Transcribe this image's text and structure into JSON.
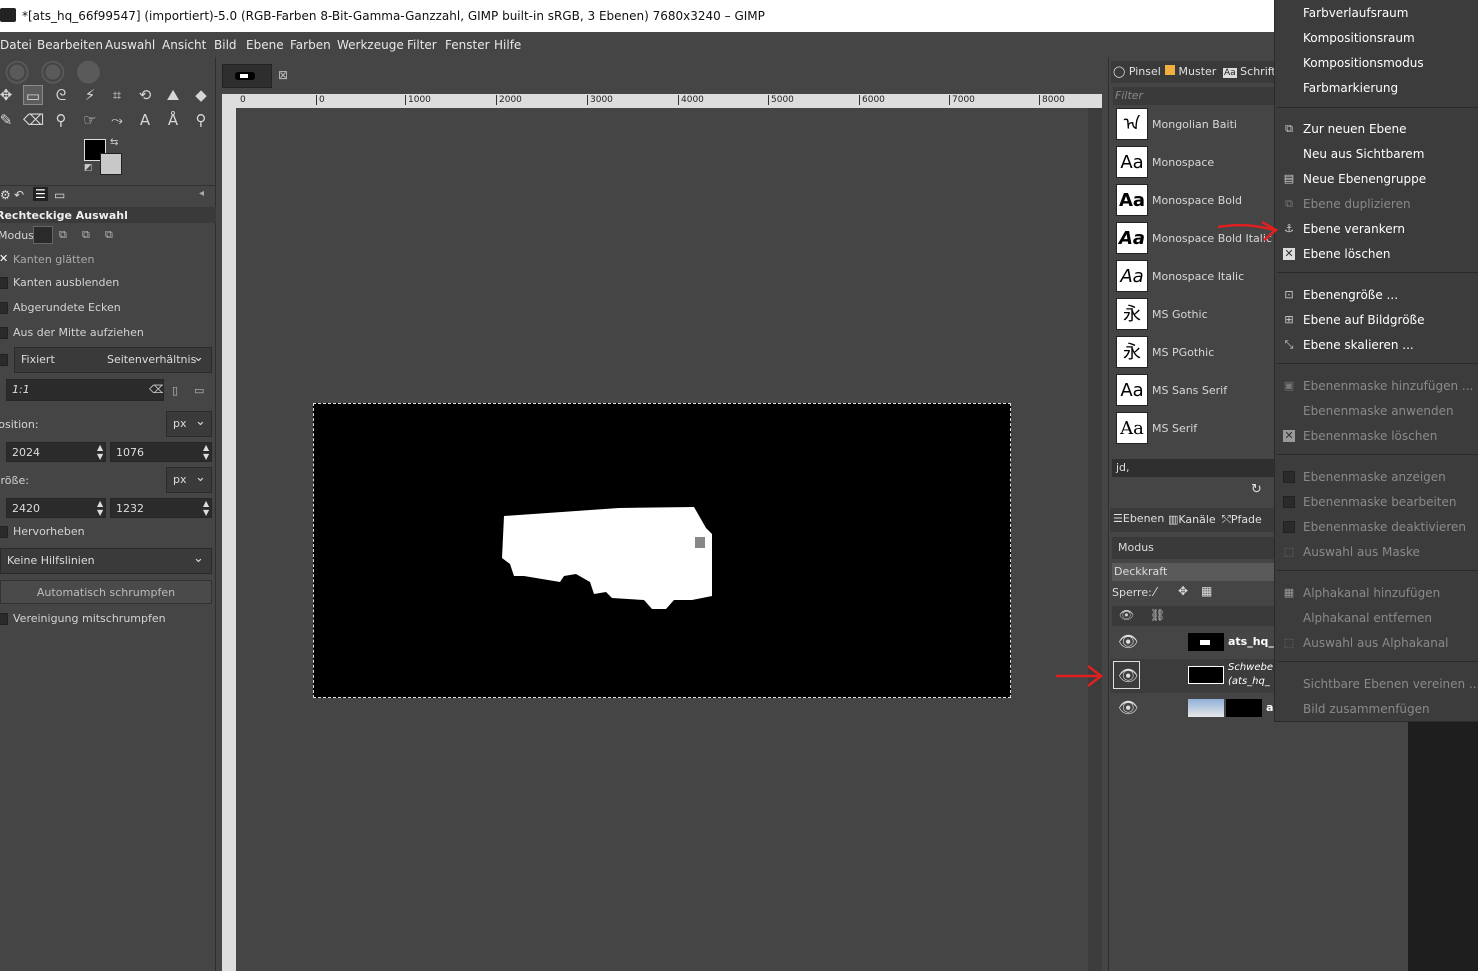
{
  "title": "*[ats_hq_66f99547] (importiert)-5.0 (RGB-Farben 8-Bit-Gamma-Ganzzahl, GIMP built-in sRGB, 3 Ebenen) 7680x3240 – GIMP",
  "menubar": [
    "Datei",
    "Bearbeiten",
    "Auswahl",
    "Ansicht",
    "Bild",
    "Ebene",
    "Farben",
    "Werkzeuge",
    "Filter",
    "Fenster",
    "Hilfe"
  ],
  "tool_options": {
    "header": "Rechteckige Auswahl",
    "mode_label": "Modus:",
    "antialias": "Kanten glätten",
    "feather": "Kanten ausblenden",
    "rounded": "Abgerundete Ecken",
    "from_center": "Aus der Mitte aufziehen",
    "fixed": "Fixiert",
    "fixed_mode": "Seitenverhältnis",
    "ratio": "1:1",
    "position_label": "Position:",
    "size_label": "Größe:",
    "unit": "px",
    "pos_x": "2024",
    "pos_y": "1076",
    "size_w": "2420",
    "size_h": "1232",
    "highlight": "Hervorheben",
    "guides": "Keine Hilfslinien",
    "autoshrink": "Automatisch schrumpfen",
    "merge_shrink": "Vereinigung mitschrumpfen"
  },
  "ruler_labels": [
    "0",
    "1000",
    "2000",
    "3000",
    "4000",
    "5000",
    "6000",
    "7000",
    "8000"
  ],
  "brush_tabs": [
    "Pinsel",
    "Muster",
    "Schrifte"
  ],
  "filter_placeholder": "Filter",
  "fonts": [
    {
      "name": "Mongolian Baiti",
      "preview": "ᠠ"
    },
    {
      "name": "Monospace",
      "preview": "Aa"
    },
    {
      "name": "Monospace Bold",
      "preview": "Aa"
    },
    {
      "name": "Monospace Bold Italic",
      "preview": "Aa"
    },
    {
      "name": "Monospace Italic",
      "preview": "Aa"
    },
    {
      "name": "MS Gothic",
      "preview": "永"
    },
    {
      "name": "MS PGothic",
      "preview": "永"
    },
    {
      "name": "MS Sans Serif",
      "preview": "Aa"
    },
    {
      "name": "MS Serif",
      "preview": "Aa"
    }
  ],
  "font_entry": "jd,",
  "layer_tabs": [
    "Ebenen",
    "Kanäle",
    "Pfade"
  ],
  "layers_panel": {
    "mode": "Modus",
    "opacity": "Deckkraft",
    "lock": "Sperre:",
    "layers": [
      {
        "name": "ats_hq_"
      },
      {
        "name": "Schwebe",
        "sub": "(ats_hq_"
      },
      {
        "name": "a"
      }
    ]
  },
  "context_menu": [
    {
      "label": "Farbverlaufsraum",
      "disabled": false,
      "icon": ""
    },
    {
      "label": "Kompositionsraum",
      "disabled": false,
      "icon": ""
    },
    {
      "label": "Kompositionsmodus",
      "disabled": false,
      "icon": ""
    },
    {
      "label": "Farbmarkierung",
      "disabled": false,
      "icon": ""
    },
    {
      "label": "Zur neuen Ebene",
      "disabled": false,
      "icon": "layer-new-icon"
    },
    {
      "label": "Neu aus Sichtbarem",
      "disabled": false,
      "icon": ""
    },
    {
      "label": "Neue Ebenengruppe",
      "disabled": false,
      "icon": "layer-group-icon"
    },
    {
      "label": "Ebene duplizieren",
      "disabled": true,
      "icon": "duplicate-icon"
    },
    {
      "label": "Ebene verankern",
      "disabled": false,
      "icon": "anchor-icon"
    },
    {
      "label": "Ebene löschen",
      "disabled": false,
      "icon": "delete-icon"
    },
    {
      "label": "Ebenengröße ...",
      "disabled": false,
      "icon": "resize-icon"
    },
    {
      "label": "Ebene auf Bildgröße",
      "disabled": false,
      "icon": "fit-icon"
    },
    {
      "label": "Ebene skalieren ...",
      "disabled": false,
      "icon": "scale-icon"
    },
    {
      "label": "Ebenenmaske hinzufügen ...",
      "disabled": true,
      "icon": "mask-add-icon"
    },
    {
      "label": "Ebenenmaske anwenden",
      "disabled": true,
      "icon": ""
    },
    {
      "label": "Ebenenmaske löschen",
      "disabled": true,
      "icon": "delete-icon"
    },
    {
      "label": "Ebenenmaske anzeigen",
      "disabled": true,
      "icon": "checkbox-icon"
    },
    {
      "label": "Ebenenmaske bearbeiten",
      "disabled": true,
      "icon": "checkbox-icon"
    },
    {
      "label": "Ebenenmaske deaktivieren",
      "disabled": true,
      "icon": "checkbox-icon"
    },
    {
      "label": "Auswahl aus Maske",
      "disabled": true,
      "icon": "selection-icon"
    },
    {
      "label": "Alphakanal hinzufügen",
      "disabled": true,
      "icon": "alpha-icon"
    },
    {
      "label": "Alphakanal entfernen",
      "disabled": true,
      "icon": ""
    },
    {
      "label": "Auswahl aus Alphakanal",
      "disabled": true,
      "icon": "selection-icon"
    },
    {
      "label": "Sichtbare Ebenen vereinen ...",
      "disabled": true,
      "icon": ""
    },
    {
      "label": "Bild zusammenfügen",
      "disabled": true,
      "icon": ""
    }
  ],
  "colors": {
    "annotation_arrow": "#e02020",
    "canvas_bg": "#454545",
    "menu_bg": "#3c3c3c"
  }
}
